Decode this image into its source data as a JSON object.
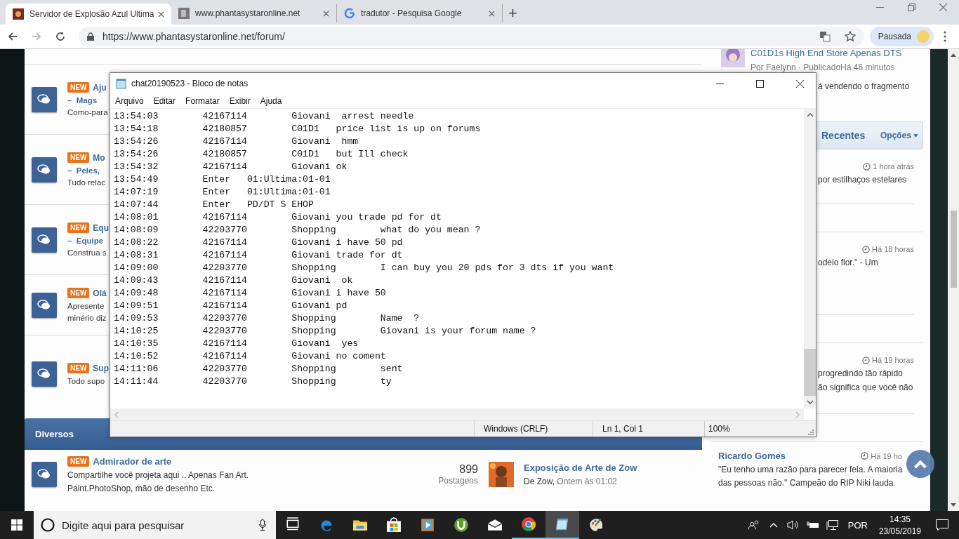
{
  "browser": {
    "tabs": [
      {
        "title": "Servidor de Explosão Azul Ultima",
        "selected": true
      },
      {
        "title": "www.phantasystaronline.net",
        "selected": false
      },
      {
        "title": "tradutor - Pesquisa Google",
        "selected": false
      }
    ],
    "new_tab": "+",
    "address": "https://www.phantasystaronline.net/forum/",
    "forward_disabled": true,
    "profile": "Pausada"
  },
  "forum": {
    "items": [
      {
        "badge": "NEW",
        "title": "Aju",
        "subtitle": "–  Mags",
        "description": [
          "Como-para"
        ]
      },
      {
        "badge": "NEW",
        "title": "Mo",
        "subtitle": "–  Peles,",
        "description": [
          "Tudo relac"
        ]
      },
      {
        "badge": "NEW",
        "title": "Equ",
        "subtitle": "–  Equipe",
        "description": [
          "Construa s"
        ]
      },
      {
        "badge": "NEW",
        "title": "Olá",
        "description": [
          "Apresente",
          "minério diz"
        ]
      },
      {
        "badge": "NEW",
        "title": "Sup",
        "description": [
          "Todo supo"
        ]
      }
    ],
    "section": "Diversos",
    "bottom_item": {
      "badge": "NEW",
      "title": "Admirador de arte",
      "description": [
        "Compartilhe você projeta aqui .. Apenas Fan Art.",
        "Paint.PhotoShop, mão de desenho Etc."
      ],
      "count": "899",
      "count_label": "Postagens",
      "last_post_title": "Exposição de Arte de Zow",
      "last_post_author": "De Zow,",
      "last_post_time": "Ontem às 01:02"
    }
  },
  "sidebar": {
    "topic": {
      "title": "C01D1s High End Store Apenas DTS",
      "meta": "Por Faelynn · PublicadoHá 46 minutos",
      "excerpt": "á vendendo o fragmento"
    },
    "header": "Recentes",
    "options": "Opções",
    "entries": [
      {
        "time": "1 hora atrás",
        "lines": [
          "por estilhaços estelares"
        ]
      },
      {
        "time": "Há 18 horas",
        "lines": [
          "odeio flor.\" - Um"
        ]
      },
      {
        "time": "Há 19 horas",
        "lines": [
          "progredindo tão rápido",
          "ão significa que você não"
        ]
      }
    ],
    "last": {
      "author": "Ricardo Gomes",
      "time": "Há 19 ho",
      "lines": [
        "\"Eu tenho uma razão para parecer feia. A maioria",
        "das pessoas não.\" Campeão do RIP Niki lauda"
      ]
    }
  },
  "notepad": {
    "title": "chat20190523 - Bloco de notas",
    "menu": [
      "Arquivo",
      "Editar",
      "Formatar",
      "Exibir",
      "Ajuda"
    ],
    "lines": [
      "13:54:03        42167114        Giovani  arrest needle",
      "13:54:18        42180857        C01D1   price list is up on forums",
      "13:54:26        42167114        Giovani  hmm",
      "13:54:26        42180857        C01D1   but Ill check",
      "13:54:32        42167114        Giovani ok",
      "13:54:49        Enter   01:Ultima:01-01",
      "14:07:19        Enter   01:Ultima:01-01",
      "14:07:44        Enter   PD/DT S EHOP",
      "14:08:01        42167114        Giovani you trade pd for dt",
      "14:08:09        42203770        Shopping        what do you mean ?",
      "14:08:22        42167114        Giovani i have 50 pd",
      "14:08:31        42167114        Giovani trade for dt",
      "14:09:00        42203770        Shopping        I can buy you 20 pds for 3 dts if you want",
      "14:09:43        42167114        Giovani  ok",
      "14:09:48        42167114        Giovani i have 50",
      "14:09:51        42167114        Giovani pd",
      "14:09:53        42203770        Shopping        Name  ?",
      "14:10:25        42203770        Shopping        Giovani is your forum name ?",
      "14:10:35        42167114        Giovani  yes",
      "14:10:52        42167114        Giovani no coment",
      "14:11:06        42203770        Shopping        sent",
      "14:11:44        42203770        Shopping        ty"
    ],
    "status": [
      "Windows (CRLF)",
      "Ln 1, Col 1",
      "100%"
    ]
  },
  "taskbar": {
    "search_placeholder": "Digite aqui para pesquisar",
    "apps": [
      {
        "kind": "taskview",
        "running": false,
        "active": false
      },
      {
        "kind": "edge",
        "running": false,
        "active": false
      },
      {
        "kind": "folder",
        "running": false,
        "active": false
      },
      {
        "kind": "store",
        "running": false,
        "active": false
      },
      {
        "kind": "media",
        "running": false,
        "active": false
      },
      {
        "kind": "torrent",
        "running": false,
        "active": false
      },
      {
        "kind": "mail",
        "running": false,
        "active": false
      },
      {
        "kind": "chrome",
        "running": true,
        "active": false
      },
      {
        "kind": "notepad",
        "running": true,
        "active": true
      },
      {
        "kind": "paint",
        "running": false,
        "active": false
      }
    ],
    "language": "POR",
    "time": "14:35",
    "date": "23/05/2019"
  }
}
